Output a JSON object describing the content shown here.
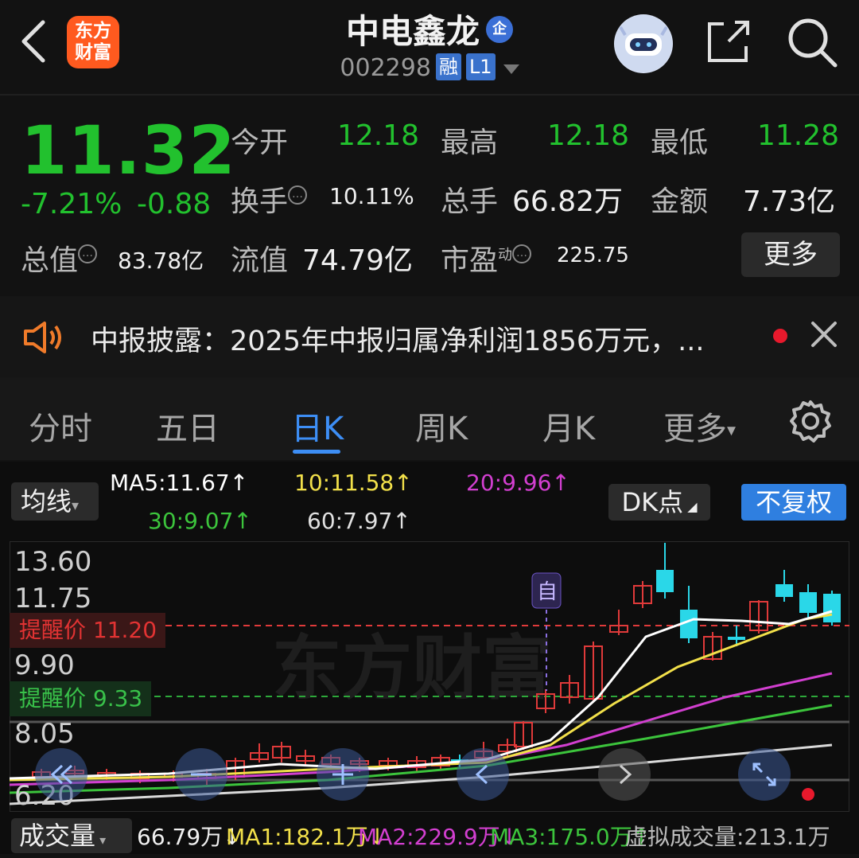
{
  "header": {
    "brand_logo_text": "东方\n财富",
    "stock_name": "中电鑫龙",
    "badge_qi": "企",
    "stock_code": "002298",
    "tag_rong": "融",
    "tag_level": "L1"
  },
  "quote": {
    "price": "11.32",
    "change_pct": "-7.21%",
    "change_amt": "-0.88",
    "open_label": "今开",
    "open": "12.18",
    "high_label": "最高",
    "high": "12.18",
    "low_label": "最低",
    "low": "11.28",
    "turnover_label": "换手",
    "turnover": "10.11%",
    "volume_label": "总手",
    "volume": "66.82万",
    "amount_label": "金额",
    "amount": "7.73亿",
    "mktcap_label": "总值",
    "mktcap": "83.78亿",
    "float_label": "流值",
    "float": "74.79亿",
    "pe_label": "市盈",
    "pe_sup": "动",
    "pe": "225.75",
    "more_label": "更多"
  },
  "news": {
    "text": "中报披露：2025年中报归属净利润1856万元，..."
  },
  "tabs": [
    "分时",
    "五日",
    "日K",
    "周K",
    "月K",
    "更多"
  ],
  "active_tab": "日K",
  "chart": {
    "indicator_label": "均线",
    "ma5": "MA5:11.67↑",
    "ma10": "10:11.58↑",
    "ma20": "20:9.96↑",
    "ma30": "30:9.07↑",
    "ma60": "60:7.97↑",
    "dk_label": "DK点",
    "fq_label": "不复权",
    "y_labels": [
      "13.60",
      "11.75",
      "9.90",
      "8.05",
      "6.20"
    ],
    "remind_high": "提醒价 11.20",
    "remind_low": "提醒价 9.33",
    "self_marker": "自",
    "watermark": "东方财富",
    "colors": {
      "ma5": "#ffffff",
      "ma10": "#f2e04a",
      "ma20": "#d23fd0",
      "ma30": "#3cc43c",
      "ma60": "#d9d9d9",
      "up": "#e03a3a",
      "down": "#2ad7e8"
    }
  },
  "volume": {
    "label": "成交量",
    "vol": "66.79万↓",
    "ma1": "MA1:182.1万↓",
    "ma2": "MA2:229.9万↓",
    "ma3": "MA3:175.0万↑",
    "virtual": "虚拟成交量:213.1万"
  }
}
